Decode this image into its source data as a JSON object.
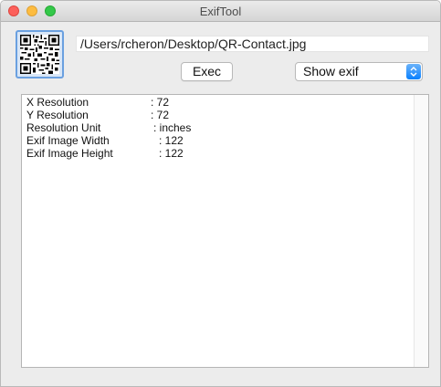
{
  "window": {
    "title": "ExifTool"
  },
  "file": {
    "path": "/Users/rcheron/Desktop/QR-Contact.jpg",
    "thumbnail_icon": "qr-code-icon"
  },
  "toolbar": {
    "exec_label": "Exec",
    "mode_selected": "Show exif"
  },
  "output": {
    "lines": [
      {
        "key": "X Resolution",
        "value": ": 72"
      },
      {
        "key": "Y Resolution",
        "value": ": 72"
      },
      {
        "key": "Resolution Unit",
        "value": ": inches"
      },
      {
        "key": "Exif Image Width",
        "value": ": 122"
      },
      {
        "key": "Exif Image Height",
        "value": ": 122"
      }
    ]
  },
  "colors": {
    "accent": "#0a80fe",
    "close": "#fc605b",
    "minimize": "#fdbc40",
    "maximize": "#34c84a"
  }
}
